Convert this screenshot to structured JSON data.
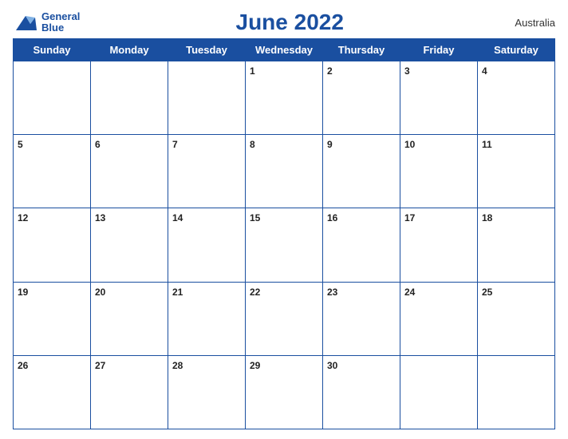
{
  "header": {
    "logo": {
      "line1": "General",
      "line2": "Blue"
    },
    "title": "June 2022",
    "country": "Australia"
  },
  "days_of_week": [
    "Sunday",
    "Monday",
    "Tuesday",
    "Wednesday",
    "Thursday",
    "Friday",
    "Saturday"
  ],
  "weeks": [
    [
      null,
      null,
      null,
      1,
      2,
      3,
      4
    ],
    [
      5,
      6,
      7,
      8,
      9,
      10,
      11
    ],
    [
      12,
      13,
      14,
      15,
      16,
      17,
      18
    ],
    [
      19,
      20,
      21,
      22,
      23,
      24,
      25
    ],
    [
      26,
      27,
      28,
      29,
      30,
      null,
      null
    ]
  ]
}
